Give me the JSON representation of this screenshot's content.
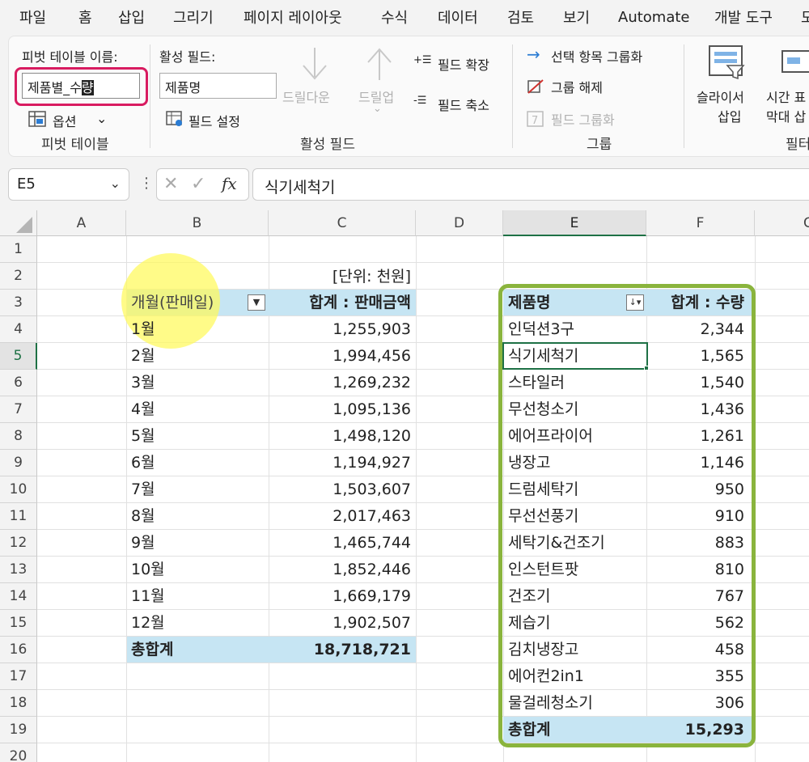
{
  "menu": [
    "파일",
    "홈",
    "삽입",
    "그리기",
    "페이지 레이아웃",
    "수식",
    "데이터",
    "검토",
    "보기",
    "Automate",
    "개발 도구",
    "도"
  ],
  "ribbon": {
    "pivot": {
      "name_label": "피벗 테이블 이름:",
      "name_value_prefix": "제품별_수",
      "name_value_cursor": "량",
      "options_label": "옵션",
      "group_label": "피벗 테이블"
    },
    "active_field": {
      "field_label": "활성 필드:",
      "field_value": "제품명",
      "field_settings": "필드 설정",
      "drill_down": "드릴다운",
      "drill_up": "드릴업",
      "expand": "필드 확장",
      "collapse": "필드 축소",
      "group_label": "활성 필드"
    },
    "group": {
      "group_selection": "선택 항목 그룹화",
      "ungroup": "그룹 해제",
      "group_field": "필드 그룹화",
      "group_label": "그룹"
    },
    "filter": {
      "slicer_line1": "슬라이서",
      "slicer_line2": "삽입",
      "timeline_line1": "시간 표",
      "timeline_line2": "막대 삽",
      "group_label": "필터"
    }
  },
  "formula_bar": {
    "name_box": "E5",
    "formula": "식기세척기"
  },
  "columns": [
    "A",
    "B",
    "C",
    "D",
    "E",
    "F",
    "G"
  ],
  "rows": [
    "1",
    "2",
    "3",
    "4",
    "5",
    "6",
    "7",
    "8",
    "9",
    "10",
    "11",
    "12",
    "13",
    "14",
    "15",
    "16",
    "17",
    "18",
    "19",
    "20"
  ],
  "pivot1": {
    "unit": "[단위: 천원]",
    "header_row": "개월(판매일)",
    "header_value": "합계 : 판매금액",
    "items": [
      {
        "label": "1월",
        "value": "1,255,903"
      },
      {
        "label": "2월",
        "value": "1,994,456"
      },
      {
        "label": "3월",
        "value": "1,269,232"
      },
      {
        "label": "4월",
        "value": "1,095,136"
      },
      {
        "label": "5월",
        "value": "1,498,120"
      },
      {
        "label": "6월",
        "value": "1,194,927"
      },
      {
        "label": "7월",
        "value": "1,503,607"
      },
      {
        "label": "8월",
        "value": "2,017,463"
      },
      {
        "label": "9월",
        "value": "1,465,744"
      },
      {
        "label": "10월",
        "value": "1,852,446"
      },
      {
        "label": "11월",
        "value": "1,669,179"
      },
      {
        "label": "12월",
        "value": "1,902,507"
      }
    ],
    "total_label": "총합계",
    "total_value": "18,718,721"
  },
  "pivot2": {
    "header_row": "제품명",
    "header_value": "합계 : 수량",
    "items": [
      {
        "label": "인덕션3구",
        "value": "2,344"
      },
      {
        "label": "식기세척기",
        "value": "1,565"
      },
      {
        "label": "스타일러",
        "value": "1,540"
      },
      {
        "label": "무선청소기",
        "value": "1,436"
      },
      {
        "label": "에어프라이어",
        "value": "1,261"
      },
      {
        "label": "냉장고",
        "value": "1,146"
      },
      {
        "label": "드럼세탁기",
        "value": "950"
      },
      {
        "label": "무선선풍기",
        "value": "910"
      },
      {
        "label": "세탁기&건조기",
        "value": "883"
      },
      {
        "label": "인스턴트팟",
        "value": "810"
      },
      {
        "label": "건조기",
        "value": "767"
      },
      {
        "label": "제습기",
        "value": "562"
      },
      {
        "label": "김치냉장고",
        "value": "458"
      },
      {
        "label": "에어컨2in1",
        "value": "355"
      },
      {
        "label": "물걸레청소기",
        "value": "306"
      }
    ],
    "total_label": "총합계",
    "total_value": "15,293"
  }
}
